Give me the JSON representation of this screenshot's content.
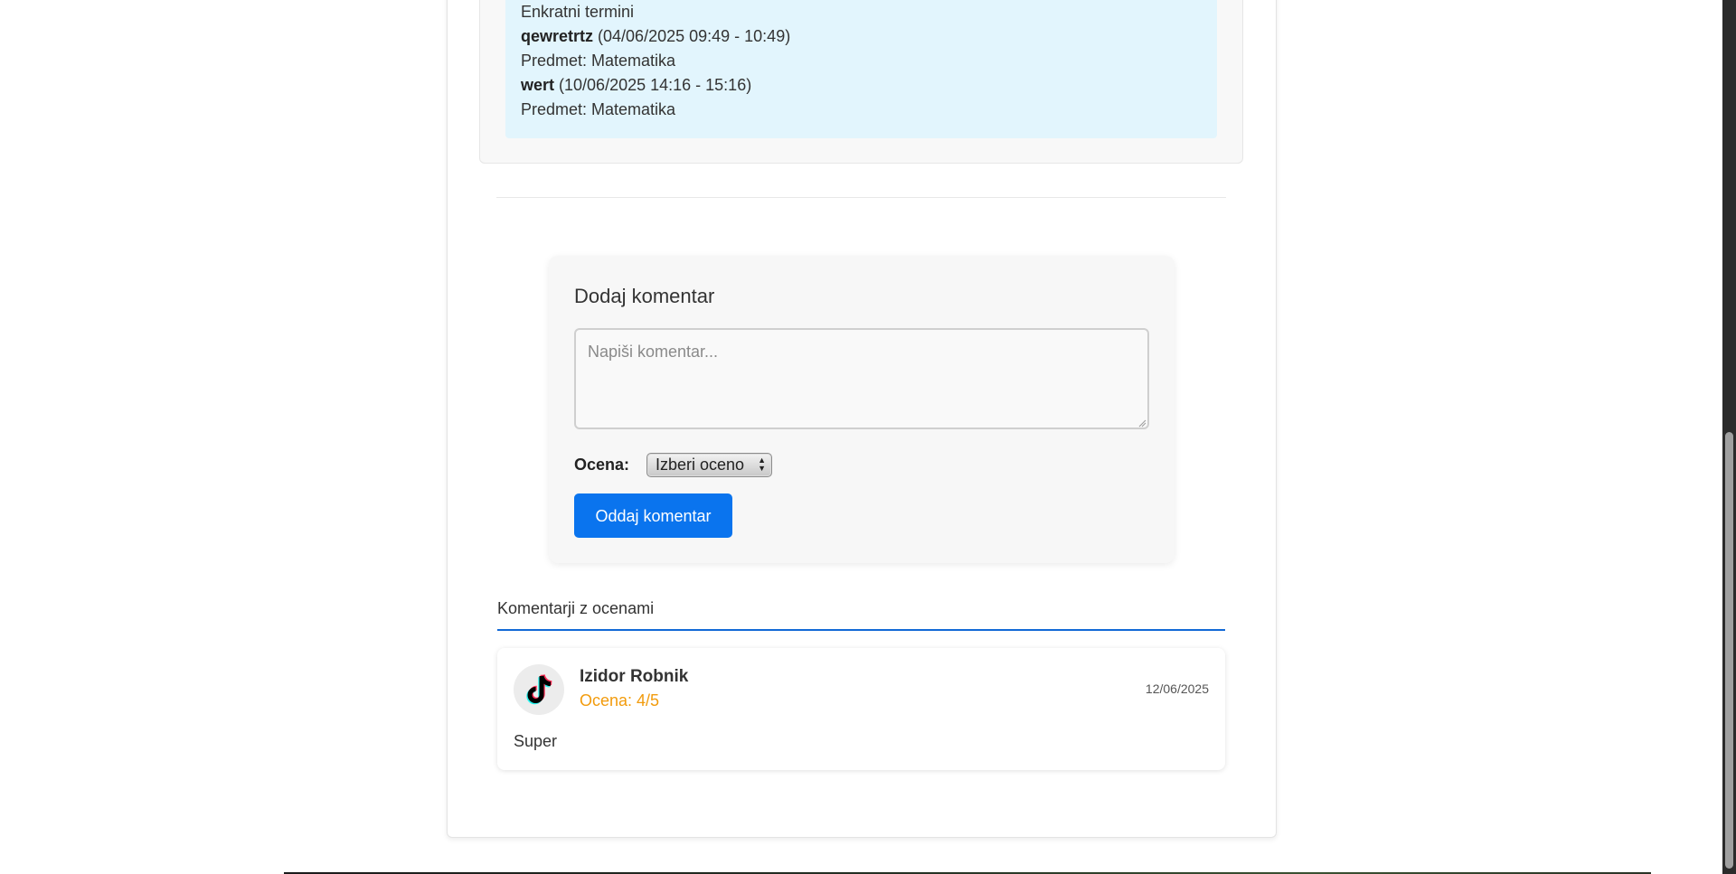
{
  "schedule": {
    "heading": "Enkratni termini",
    "entries": [
      {
        "name": "qewretrtz",
        "time": "(04/06/2025 09:49 - 10:49)",
        "subject": "Predmet: Matematika"
      },
      {
        "name": "wert",
        "time": "(10/06/2025 14:16 - 15:16)",
        "subject": "Predmet: Matematika"
      }
    ]
  },
  "comment_form": {
    "title": "Dodaj komentar",
    "placeholder": "Napiši komentar...",
    "rating_label": "Ocena:",
    "rating_selected": "Izberi oceno",
    "submit_label": "Oddaj komentar"
  },
  "comments_section": {
    "heading": "Komentarji z ocenami",
    "comments": [
      {
        "avatar_icon": "tiktok-logo-icon",
        "author": "Izidor Robnik",
        "rating": "Ocena: 4/5",
        "date": "12/06/2025",
        "text": "Super"
      }
    ]
  },
  "colors": {
    "schedule_bg": "#e2f5fd",
    "primary_button": "#0a74ee",
    "heading_underline": "#1269d6",
    "rating_text": "#f29b0c"
  }
}
